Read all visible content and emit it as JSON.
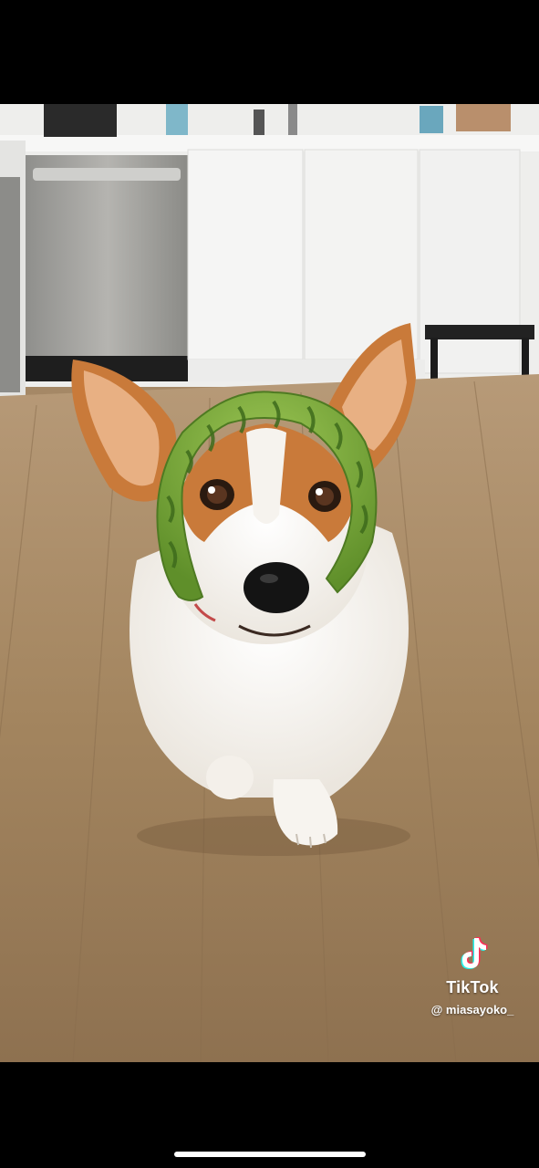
{
  "watermark": {
    "brand": "TikTok",
    "username": "@ miasayoko_",
    "logo_icon": "tiktok-note-icon"
  },
  "colors": {
    "background": "#000000",
    "floor": "#a58866",
    "cabinet": "#f2f2f0",
    "melon_green": "#7fae3e",
    "fur_orange": "#c97a3a",
    "fur_white": "#f6f3ee"
  }
}
